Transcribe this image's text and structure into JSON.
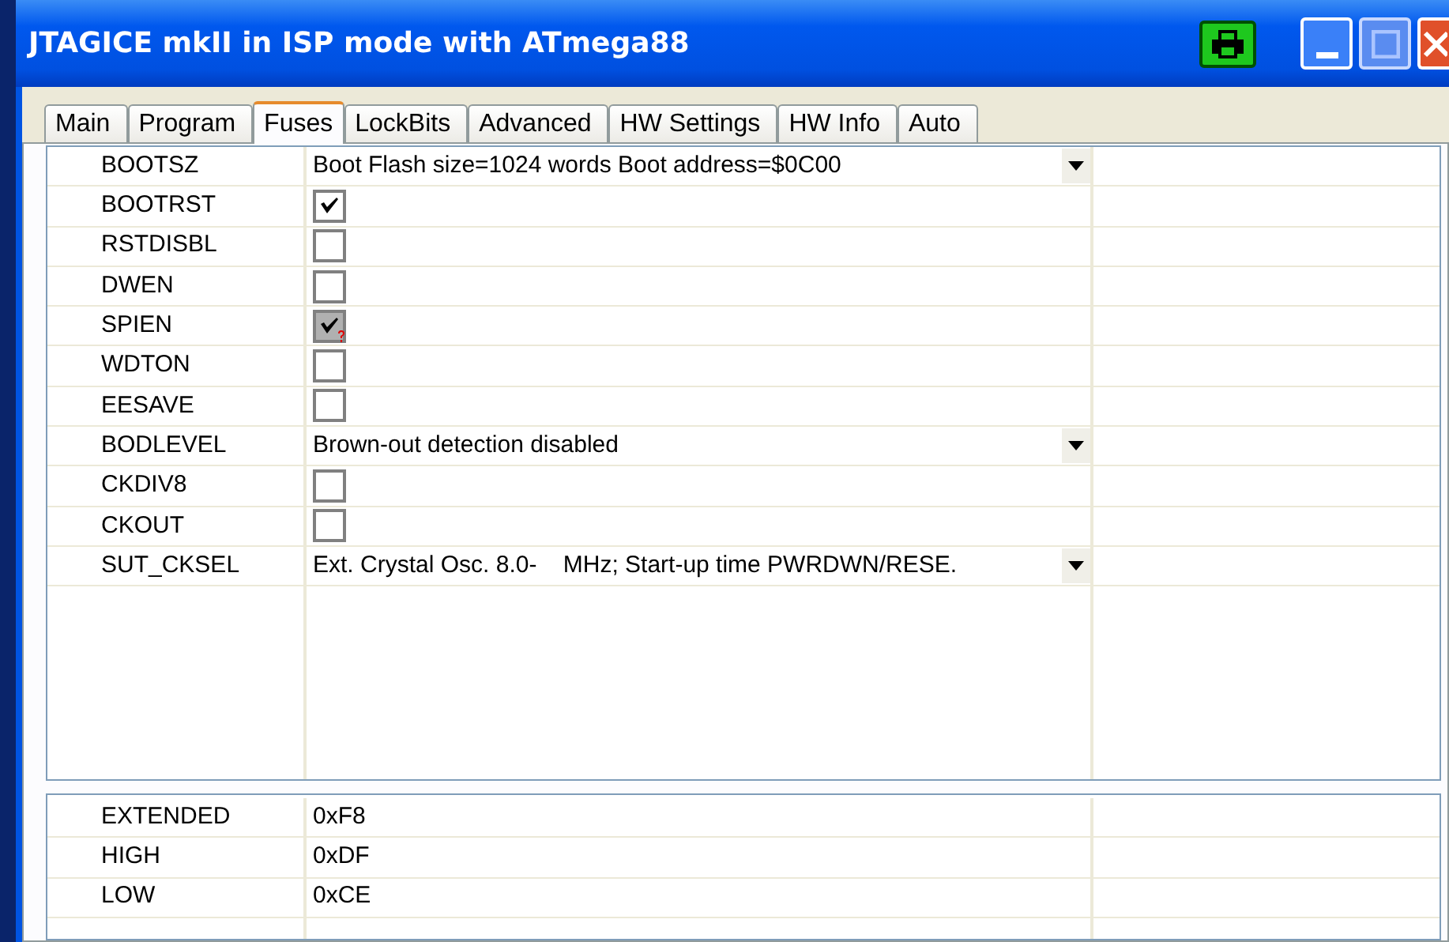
{
  "window": {
    "title": "JTAGICE mkII in ISP mode with ATmega88"
  },
  "tabs": [
    {
      "label": "Main",
      "selected": false
    },
    {
      "label": "Program",
      "selected": false
    },
    {
      "label": "Fuses",
      "selected": true
    },
    {
      "label": "LockBits",
      "selected": false
    },
    {
      "label": "Advanced",
      "selected": false
    },
    {
      "label": "HW Settings",
      "selected": false
    },
    {
      "label": "HW Info",
      "selected": false
    },
    {
      "label": "Auto",
      "selected": false
    }
  ],
  "fuses": [
    {
      "name": "BOOTSZ",
      "kind": "dropdown",
      "value": "Boot Flash size=1024 words Boot address=$0C00"
    },
    {
      "name": "BOOTRST",
      "kind": "checkbox",
      "checked": true,
      "disabled": false
    },
    {
      "name": "RSTDISBL",
      "kind": "checkbox",
      "checked": false,
      "disabled": false
    },
    {
      "name": "DWEN",
      "kind": "checkbox",
      "checked": false,
      "disabled": false
    },
    {
      "name": "SPIEN",
      "kind": "checkbox",
      "checked": true,
      "disabled": true
    },
    {
      "name": "WDTON",
      "kind": "checkbox",
      "checked": false,
      "disabled": false
    },
    {
      "name": "EESAVE",
      "kind": "checkbox",
      "checked": false,
      "disabled": false
    },
    {
      "name": "BODLEVEL",
      "kind": "dropdown",
      "value": "Brown-out detection disabled"
    },
    {
      "name": "CKDIV8",
      "kind": "checkbox",
      "checked": false,
      "disabled": false
    },
    {
      "name": "CKOUT",
      "kind": "checkbox",
      "checked": false,
      "disabled": false
    },
    {
      "name": "SUT_CKSEL",
      "kind": "dropdown",
      "value": "Ext. Crystal Osc. 8.0-    MHz; Start-up time PWRDWN/RESE."
    }
  ],
  "fuse_bytes": [
    {
      "name": "EXTENDED",
      "value": "0xF8"
    },
    {
      "name": "HIGH",
      "value": "0xDF"
    },
    {
      "name": "LOW",
      "value": "0xCE"
    }
  ]
}
